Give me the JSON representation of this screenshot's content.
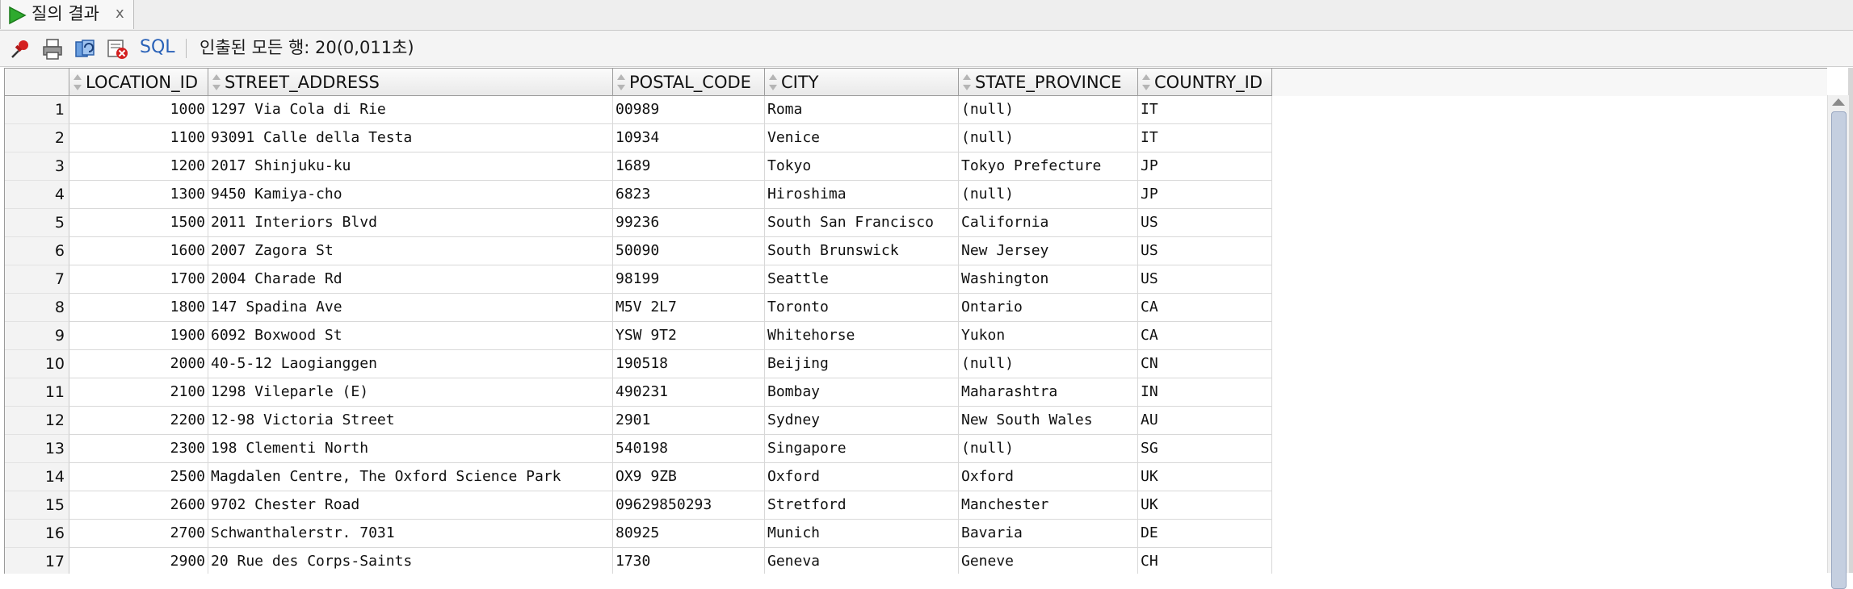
{
  "tab": {
    "label": "질의 결과",
    "close": "x"
  },
  "toolbar": {
    "sql_label": "SQL",
    "status": "인출된 모든 행: 20(0,011초)"
  },
  "columns": [
    "LOCATION_ID",
    "STREET_ADDRESS",
    "POSTAL_CODE",
    "CITY",
    "STATE_PROVINCE",
    "COUNTRY_ID"
  ],
  "rows": [
    {
      "n": "1",
      "location_id": "1000",
      "street_address": "1297 Via Cola di Rie",
      "postal_code": "00989",
      "city": "Roma",
      "state_province": "(null)",
      "country_id": "IT"
    },
    {
      "n": "2",
      "location_id": "1100",
      "street_address": "93091 Calle della Testa",
      "postal_code": "10934",
      "city": "Venice",
      "state_province": "(null)",
      "country_id": "IT"
    },
    {
      "n": "3",
      "location_id": "1200",
      "street_address": "2017 Shinjuku-ku",
      "postal_code": "1689",
      "city": "Tokyo",
      "state_province": "Tokyo Prefecture",
      "country_id": "JP"
    },
    {
      "n": "4",
      "location_id": "1300",
      "street_address": "9450 Kamiya-cho",
      "postal_code": "6823",
      "city": "Hiroshima",
      "state_province": "(null)",
      "country_id": "JP"
    },
    {
      "n": "5",
      "location_id": "1500",
      "street_address": "2011 Interiors Blvd",
      "postal_code": "99236",
      "city": "South San Francisco",
      "state_province": "California",
      "country_id": "US"
    },
    {
      "n": "6",
      "location_id": "1600",
      "street_address": "2007 Zagora St",
      "postal_code": "50090",
      "city": "South Brunswick",
      "state_province": "New Jersey",
      "country_id": "US"
    },
    {
      "n": "7",
      "location_id": "1700",
      "street_address": "2004 Charade Rd",
      "postal_code": "98199",
      "city": "Seattle",
      "state_province": "Washington",
      "country_id": "US"
    },
    {
      "n": "8",
      "location_id": "1800",
      "street_address": "147 Spadina Ave",
      "postal_code": "M5V 2L7",
      "city": "Toronto",
      "state_province": "Ontario",
      "country_id": "CA"
    },
    {
      "n": "9",
      "location_id": "1900",
      "street_address": "6092 Boxwood St",
      "postal_code": "YSW 9T2",
      "city": "Whitehorse",
      "state_province": "Yukon",
      "country_id": "CA"
    },
    {
      "n": "10",
      "location_id": "2000",
      "street_address": "40-5-12 Laogianggen",
      "postal_code": "190518",
      "city": "Beijing",
      "state_province": "(null)",
      "country_id": "CN"
    },
    {
      "n": "11",
      "location_id": "2100",
      "street_address": "1298 Vileparle (E)",
      "postal_code": "490231",
      "city": "Bombay",
      "state_province": "Maharashtra",
      "country_id": "IN"
    },
    {
      "n": "12",
      "location_id": "2200",
      "street_address": "12-98 Victoria Street",
      "postal_code": "2901",
      "city": "Sydney",
      "state_province": "New South Wales",
      "country_id": "AU"
    },
    {
      "n": "13",
      "location_id": "2300",
      "street_address": "198 Clementi North",
      "postal_code": "540198",
      "city": "Singapore",
      "state_province": "(null)",
      "country_id": "SG"
    },
    {
      "n": "14",
      "location_id": "2500",
      "street_address": "Magdalen Centre, The Oxford Science Park",
      "postal_code": "OX9 9ZB",
      "city": "Oxford",
      "state_province": "Oxford",
      "country_id": "UK"
    },
    {
      "n": "15",
      "location_id": "2600",
      "street_address": "9702 Chester Road",
      "postal_code": "09629850293",
      "city": "Stretford",
      "state_province": "Manchester",
      "country_id": "UK"
    },
    {
      "n": "16",
      "location_id": "2700",
      "street_address": "Schwanthalerstr. 7031",
      "postal_code": "80925",
      "city": "Munich",
      "state_province": "Bavaria",
      "country_id": "DE"
    },
    {
      "n": "17",
      "location_id": "2900",
      "street_address": "20 Rue des Corps-Saints",
      "postal_code": "1730",
      "city": "Geneva",
      "state_province": "Geneve",
      "country_id": "CH"
    }
  ],
  "colors": {
    "play": "#2eaa2e",
    "pin": "#d42020",
    "sql_link": "#2a62b8"
  },
  "icons": [
    "play-icon",
    "pin-icon",
    "print-icon",
    "refresh-icon",
    "clear-icon"
  ]
}
